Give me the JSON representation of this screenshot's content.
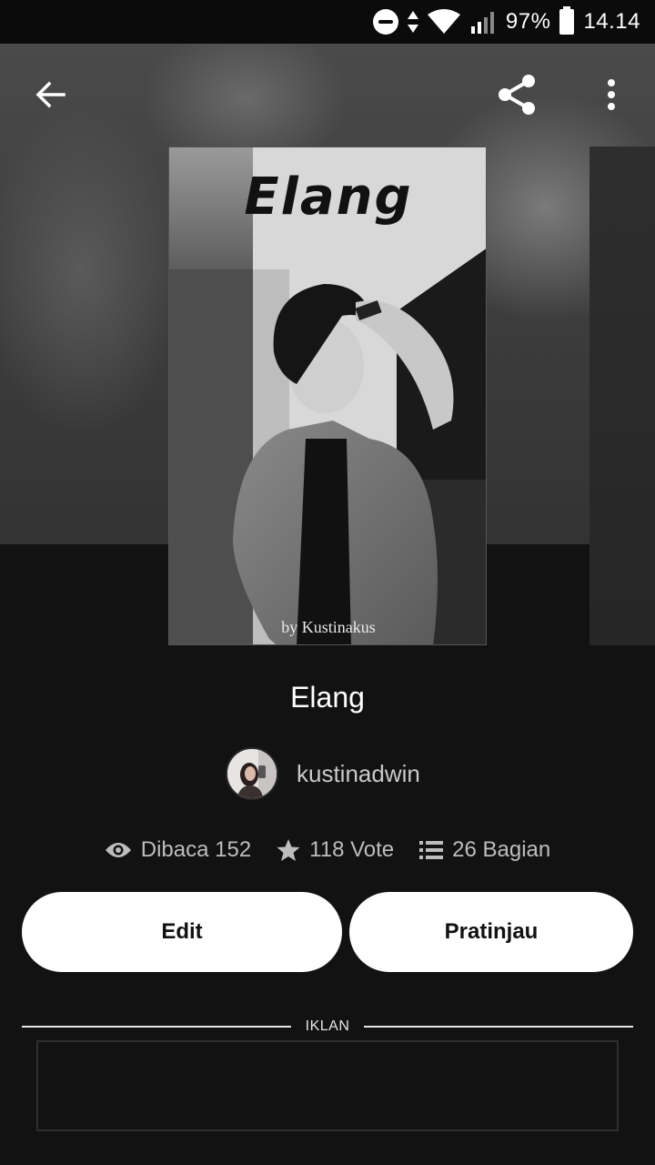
{
  "status_bar": {
    "battery": "97%",
    "time": "14.14"
  },
  "nav": {
    "back_icon": "arrow-back-icon",
    "share_icon": "share-icon",
    "more_icon": "more-vert-icon"
  },
  "cover": {
    "title": "Elang",
    "author_line": "by Kustinakus"
  },
  "story": {
    "title": "Elang",
    "author": "kustinadwin"
  },
  "stats": {
    "reads": "Dibaca 152",
    "votes": "118 Vote",
    "parts": "26 Bagian"
  },
  "actions": {
    "edit": "Edit",
    "preview": "Pratinjau"
  },
  "ad": {
    "label": "IKLAN"
  },
  "colors": {
    "background": "#121212",
    "button_bg": "#ffffff",
    "muted_text": "#bdbdbd"
  }
}
